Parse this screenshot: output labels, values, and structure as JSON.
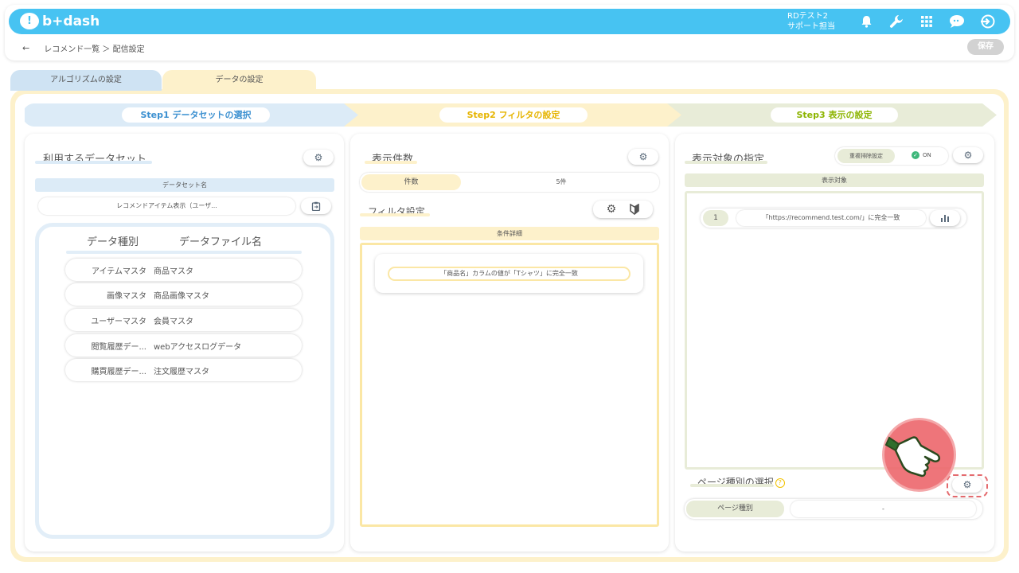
{
  "header": {
    "logo_text": "b+dash",
    "user_line1": "RDテスト2",
    "user_line2": "サポート担当",
    "icons": [
      "bell-icon",
      "wrench-icon",
      "grid-icon",
      "chat-icon",
      "logout-icon"
    ],
    "accent_color": "#47c3f2"
  },
  "breadcrumb": {
    "back": "←",
    "path": "レコメンド一覧 ＞ 配信設定"
  },
  "toolbar": {
    "save_label": "保存"
  },
  "tabs": [
    {
      "label": "アルゴリズムの設定"
    },
    {
      "label": "データの設定"
    }
  ],
  "steps": [
    {
      "label": "Step1 データセットの選択"
    },
    {
      "label": "Step2 フィルタの設定"
    },
    {
      "label": "Step3 表示の設定"
    }
  ],
  "dataset_panel": {
    "title": "利用するデータセット",
    "dataset_name_label": "データセット名",
    "dataset_name_value": "レコメンドアイテム表示（ユーザ...",
    "col_type": "データ種別",
    "col_file": "データファイル名",
    "rows": [
      {
        "type": "アイテムマスタ",
        "file": "商品マスタ"
      },
      {
        "type": "画像マスタ",
        "file": "商品画像マスタ"
      },
      {
        "type": "ユーザーマスタ",
        "file": "会員マスタ"
      },
      {
        "type": "閲覧履歴デー...",
        "file": "webアクセスログデータ"
      },
      {
        "type": "購買履歴デー...",
        "file": "注文履歴マスタ"
      }
    ]
  },
  "filter_panel": {
    "count_title": "表示件数",
    "count_label": "件数",
    "count_value": "5件",
    "filter_title": "フィルタ設定",
    "cond_label": "条件詳細",
    "condition": "「商品名」カラムの値が「Tシャツ」に完全一致"
  },
  "display_panel": {
    "title": "表示対象の指定",
    "dedupe_label": "重複排除設定",
    "dedupe_value": "ON",
    "target_label": "表示対象",
    "targets": [
      {
        "num": "1",
        "text": "「https://recommend.test.com/」に完全一致"
      }
    ],
    "pagetype_title": "ページ種別の選択",
    "pagetype_help": "?",
    "pagetype_label": "ページ種別",
    "pagetype_value": "-"
  }
}
